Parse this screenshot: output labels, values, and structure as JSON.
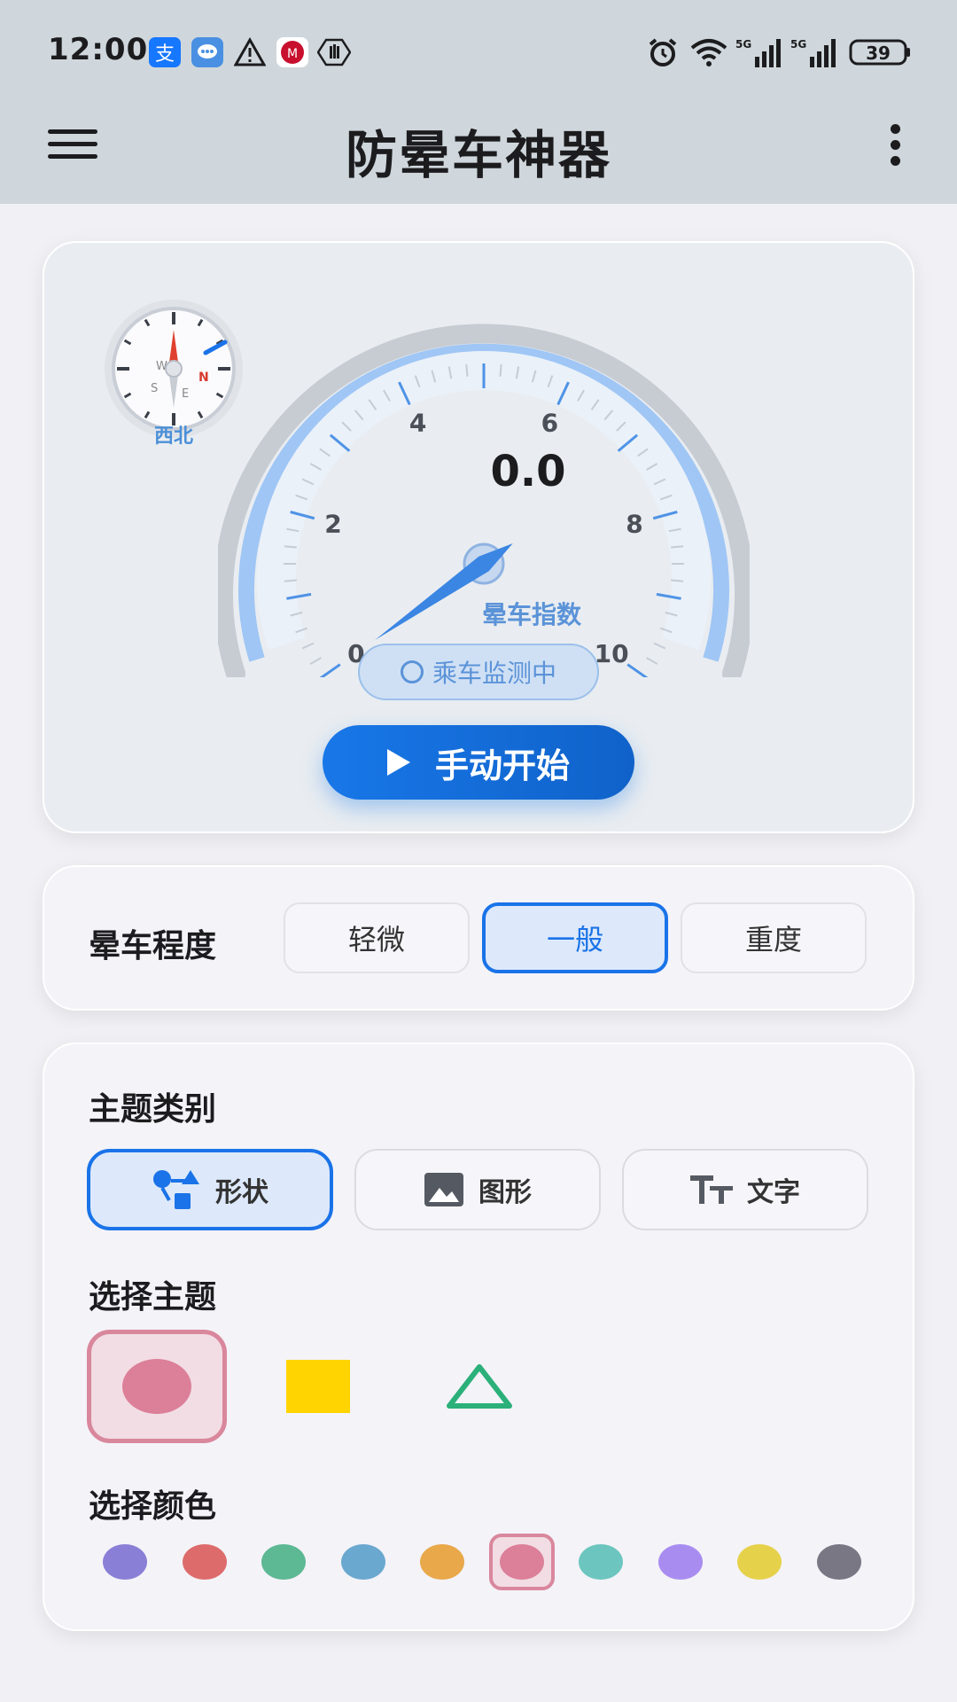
{
  "status": {
    "time": "12:00",
    "battery": "39"
  },
  "appbar": {
    "title": "防晕车神器"
  },
  "compass": {
    "direction": "西北",
    "letters": [
      "N",
      "E",
      "S",
      "W"
    ]
  },
  "gauge": {
    "value": "0.0",
    "label": "晕车指数",
    "ticks": [
      "0",
      "2",
      "4",
      "6",
      "8",
      "10"
    ],
    "level": 0,
    "max": 10,
    "monitor_text": "乘车监测中",
    "start_label": "手动开始"
  },
  "level": {
    "title": "晕车程度",
    "options": [
      "轻微",
      "一般",
      "重度"
    ],
    "selected": "一般"
  },
  "theme": {
    "category_title": "主题类别",
    "categories": [
      "形状",
      "图形",
      "文字"
    ],
    "selected_category": "形状",
    "choose_title": "选择主题",
    "shapes": [
      "circle",
      "square",
      "triangle"
    ],
    "selected_shape": "circle",
    "color_title": "选择颜色",
    "colors": [
      "#8a7fd6",
      "#dd6b6b",
      "#5db894",
      "#6aa8cf",
      "#e9a84a",
      "#dc7f99",
      "#6cc6bf",
      "#a98cf0",
      "#e6d14a",
      "#7a7784"
    ],
    "selected_color": "#dc7f99"
  },
  "colors": {
    "accent": "#1a73e8",
    "topbar": "#cfd7dc",
    "selected_pink": "#d9879d"
  }
}
